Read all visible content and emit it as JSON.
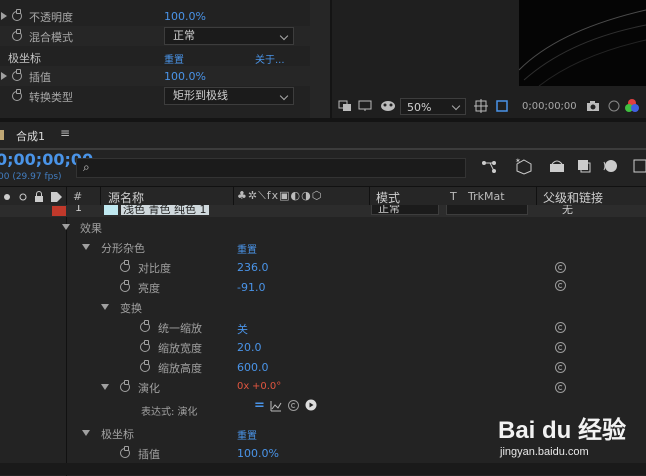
{
  "effect_controls": {
    "opacity_label": "不透明度",
    "opacity_value": "100.0%",
    "blend_label": "混合模式",
    "blend_value": "正常",
    "polar_section": "极坐标",
    "polar_reset": "重置",
    "polar_about": "关于...",
    "interp_label": "插值",
    "interp_value": "100.0%",
    "convert_label": "转换类型",
    "convert_value": "矩形到极线"
  },
  "viewer": {
    "zoom": "50%",
    "timecode": "0;00;00;00"
  },
  "timeline": {
    "comp_tab": "合成1",
    "timecode": "0;00;00;00",
    "fps": "00 (29.97 fps)",
    "columns": {
      "hash": "#",
      "source_name": "源名称",
      "mode": "模式",
      "t": "T",
      "trkmat": "TrkMat",
      "parent": "父级和链接"
    },
    "layer": {
      "index": "1",
      "name": "浅色 青色 纯色 1",
      "mode": "正常",
      "parent": "无"
    },
    "effects_label": "效果",
    "fractal": {
      "name": "分形杂色",
      "reset": "重置",
      "contrast_label": "对比度",
      "contrast_value": "236.0",
      "brightness_label": "亮度",
      "brightness_value": "-91.0"
    },
    "transform": {
      "name": "变换",
      "uniform_label": "统一缩放",
      "uniform_value": "关",
      "width_label": "缩放宽度",
      "width_value": "20.0",
      "height_label": "缩放高度",
      "height_value": "600.0"
    },
    "evolution": {
      "label": "演化",
      "value_x": "0x",
      "value_deg": "+0.0°",
      "expression_label": "表达式: 演化"
    },
    "polar": {
      "name": "极坐标",
      "reset": "重置",
      "interp_label": "插值",
      "interp_value": "100.0%"
    }
  },
  "watermark": {
    "brand": "Bai du 经验",
    "url": "jingyan.baidu.com"
  },
  "colors": {
    "accent_blue": "#4a94e8",
    "red_value": "#e0553f",
    "label_red": "#c0392b"
  }
}
